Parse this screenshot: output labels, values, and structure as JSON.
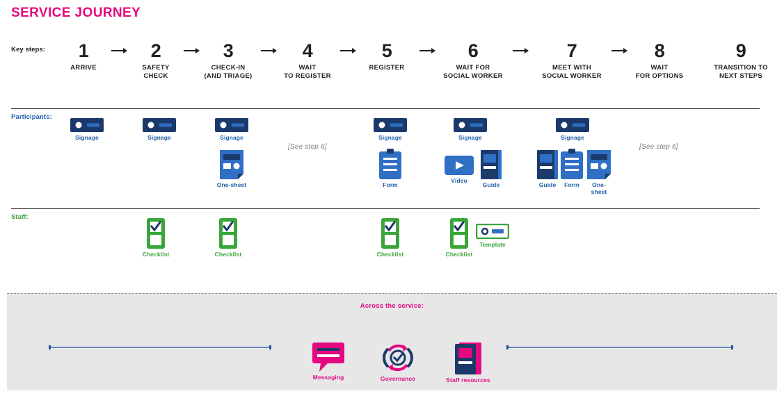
{
  "title": "SERVICE JOURNEY",
  "rows": {
    "key_steps_label": "Key steps:",
    "participants_label": "Participants:",
    "staff_label": "Staff:"
  },
  "steps": [
    {
      "num": "1",
      "label": "ARRIVE"
    },
    {
      "num": "2",
      "label": "SAFETY\nCHECK"
    },
    {
      "num": "3",
      "label": "CHECK-IN\n(AND TRIAGE)"
    },
    {
      "num": "4",
      "label": "WAIT\nTO REGISTER"
    },
    {
      "num": "5",
      "label": "REGISTER"
    },
    {
      "num": "6",
      "label": "WAIT FOR\nSOCIAL WORKER"
    },
    {
      "num": "7",
      "label": "MEET WITH\nSOCIAL WORKER"
    },
    {
      "num": "8",
      "label": "WAIT\nFOR OPTIONS"
    },
    {
      "num": "9",
      "label": "TRANSITION TO\nNEXT STEPS"
    }
  ],
  "participants": {
    "step1": [
      {
        "icon": "signage-icon",
        "caption": "Signage"
      }
    ],
    "step2": [
      {
        "icon": "signage-icon",
        "caption": "Signage"
      }
    ],
    "step3": [
      {
        "icon": "signage-icon",
        "caption": "Signage"
      },
      {
        "icon": "one-sheet-icon",
        "caption": "One-sheet"
      }
    ],
    "step4": {
      "note": "[See step 6]"
    },
    "step5": [
      {
        "icon": "signage-icon",
        "caption": "Signage"
      },
      {
        "icon": "form-icon",
        "caption": "Form"
      }
    ],
    "step6": [
      {
        "icon": "signage-icon",
        "caption": "Signage"
      },
      {
        "icon": "video-icon",
        "caption": "Video"
      },
      {
        "icon": "guide-icon",
        "caption": "Guide"
      }
    ],
    "step7": [
      {
        "icon": "signage-icon",
        "caption": "Signage"
      },
      {
        "icon": "guide-icon",
        "caption": "Guide"
      },
      {
        "icon": "form-icon",
        "caption": "Form"
      },
      {
        "icon": "one-sheet-icon",
        "caption": "One-sheet"
      }
    ],
    "step8": {
      "note": "[See step 6]"
    }
  },
  "staff": {
    "step2": [
      {
        "icon": "checklist-icon",
        "caption": "Checklist"
      }
    ],
    "step3": [
      {
        "icon": "checklist-icon",
        "caption": "Checklist"
      }
    ],
    "step5": [
      {
        "icon": "checklist-icon",
        "caption": "Checklist"
      }
    ],
    "step6": [
      {
        "icon": "checklist-icon",
        "caption": "Checklist"
      },
      {
        "icon": "template-icon",
        "caption": "Template"
      }
    ]
  },
  "across_service": {
    "title": "Across the service:",
    "items": [
      {
        "icon": "messaging-icon",
        "caption": "Messaging"
      },
      {
        "icon": "governance-icon",
        "caption": "Governance"
      },
      {
        "icon": "staff-resources-icon",
        "caption": "Staff resources"
      }
    ]
  },
  "colors": {
    "pink": "#e5097f",
    "blue": "#1f5faa",
    "navy": "#1b3a6b",
    "green": "#3aa63a",
    "band": "#e7e7e7",
    "line": "#7089b5"
  }
}
